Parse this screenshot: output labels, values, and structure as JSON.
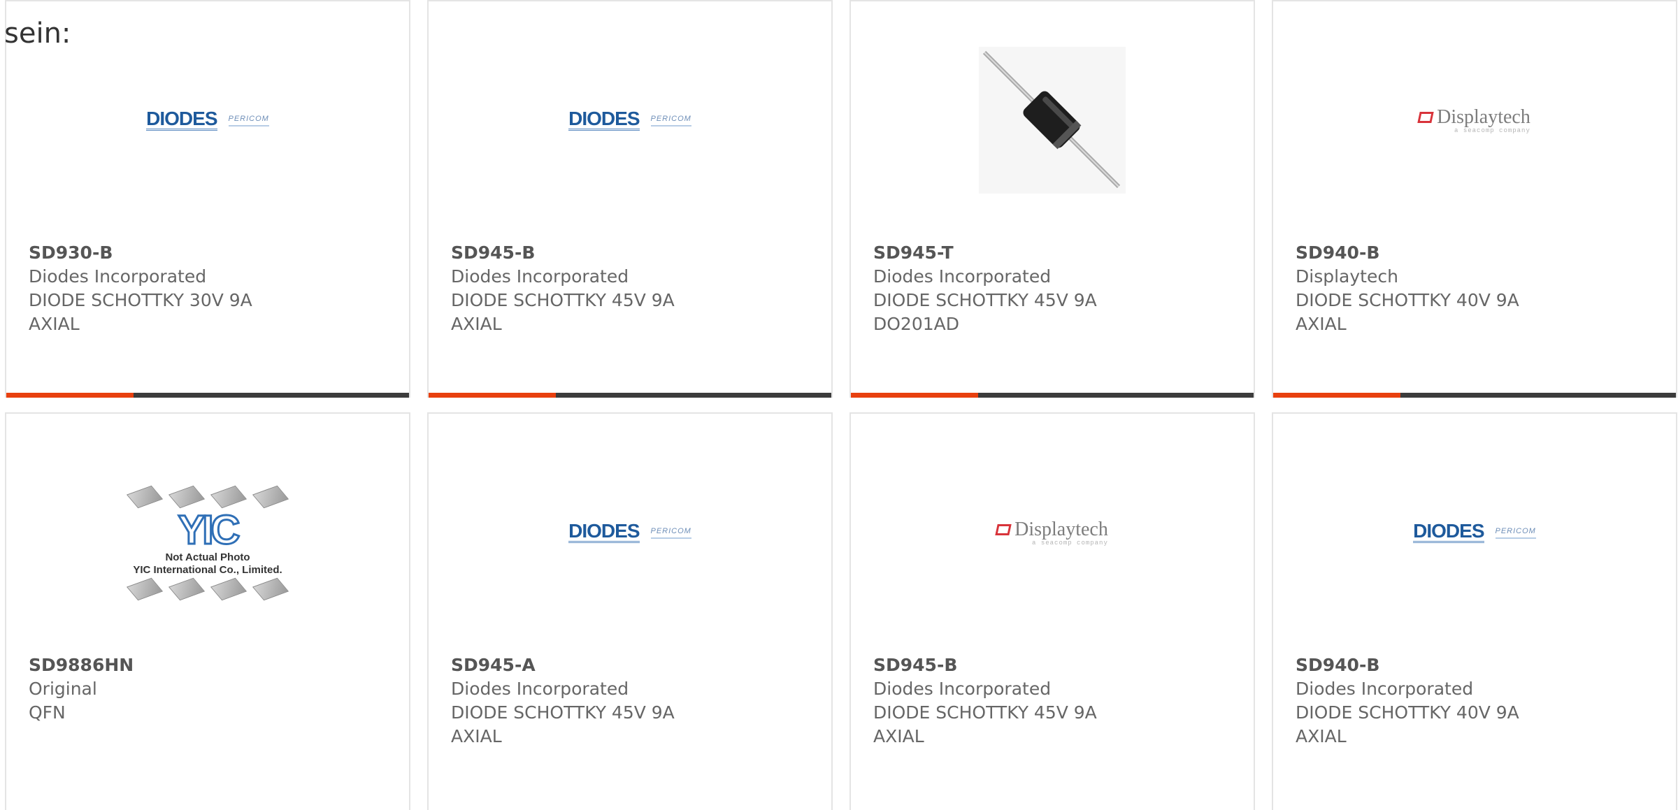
{
  "intro_text": "sein:",
  "colors": {
    "accent": "#e8400f",
    "bar": "#3c3c3c",
    "border": "#e4e4e4"
  },
  "products": [
    {
      "part": "SD930-B",
      "manufacturer": "Diodes Incorporated",
      "description": "DIODE SCHOTTKY 30V 9A AXIAL",
      "image": "diodes-logo"
    },
    {
      "part": "SD945-B",
      "manufacturer": "Diodes Incorporated",
      "description": "DIODE SCHOTTKY 45V 9A AXIAL",
      "image": "diodes-logo"
    },
    {
      "part": "SD945-T",
      "manufacturer": "Diodes Incorporated",
      "description": "DIODE SCHOTTKY 45V 9A DO201AD",
      "image": "axial-diode-photo"
    },
    {
      "part": "SD940-B",
      "manufacturer": "Displaytech",
      "description": "DIODE SCHOTTKY 40V 9A AXIAL",
      "image": "displaytech-logo"
    },
    {
      "part": "SD9886HN",
      "manufacturer": "Original",
      "description": "QFN",
      "image": "yic-placeholder"
    },
    {
      "part": "SD945-A",
      "manufacturer": "Diodes Incorporated",
      "description": "DIODE SCHOTTKY 45V 9A AXIAL",
      "image": "diodes-logo"
    },
    {
      "part": "SD945-B",
      "manufacturer": "Diodes Incorporated",
      "description": "DIODE SCHOTTKY 45V 9A AXIAL",
      "image": "displaytech-logo"
    },
    {
      "part": "SD940-B",
      "manufacturer": "Diodes Incorporated",
      "description": "DIODE SCHOTTKY 40V 9A AXIAL",
      "image": "diodes-logo"
    }
  ],
  "logos": {
    "diodes": {
      "word": "DIODES",
      "sub": "PERICOM"
    },
    "displaytech": {
      "word": "Displaytech",
      "sub": "a seacomp company"
    },
    "yic": {
      "word": "YIC",
      "line1": "Not Actual Photo",
      "line2": "YIC International Co., Limited."
    }
  }
}
